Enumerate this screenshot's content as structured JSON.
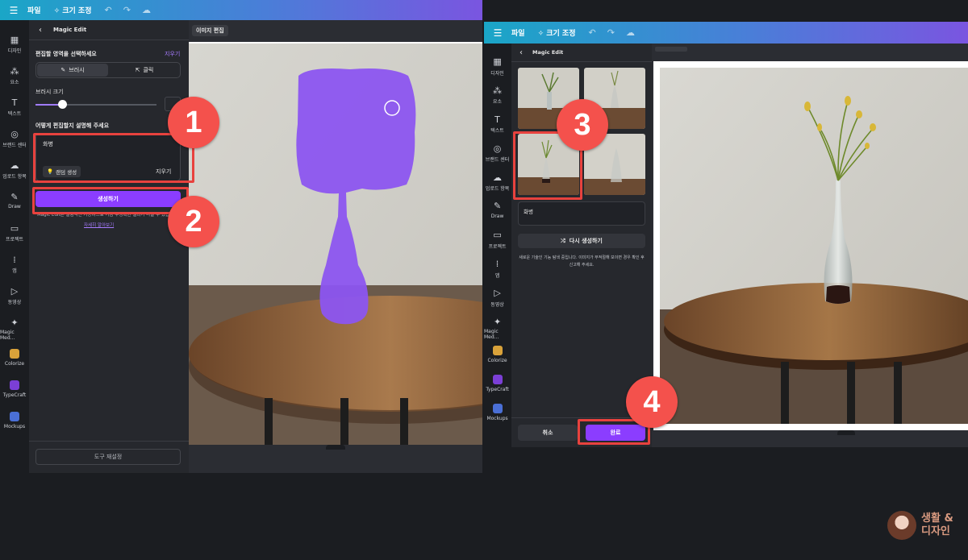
{
  "left": {
    "topbar": {
      "menu_icon": "menu-icon",
      "file": "파일",
      "resize": "✧ 크기 조정"
    },
    "rail": [
      {
        "label": "디자인",
        "icon": "▦"
      },
      {
        "label": "요소",
        "icon": "⁂"
      },
      {
        "label": "텍스트",
        "icon": "T"
      },
      {
        "label": "브랜드 센터",
        "icon": "◎"
      },
      {
        "label": "업로드 항목",
        "icon": "☁"
      },
      {
        "label": "Draw",
        "icon": "✎"
      },
      {
        "label": "프로젝트",
        "icon": "▭"
      },
      {
        "label": "앱",
        "icon": "⁞"
      },
      {
        "label": "동영상",
        "icon": "▷"
      },
      {
        "label": "Magic Med...",
        "icon": "✦"
      },
      {
        "label": "Colorize",
        "icon": ""
      },
      {
        "label": "TypeCraft",
        "icon": ""
      },
      {
        "label": "Mockups",
        "icon": ""
      }
    ],
    "panel": {
      "back": "‹",
      "title": "Magic Edit",
      "select_area": "편집할 영역을 선택하세요",
      "clear": "지우기",
      "tab_brush": "브러시",
      "tab_click": "클릭",
      "brush_size": "브러시 크기",
      "brush_value": 22,
      "describe": "어떻게 편집할지 설명해 주세요",
      "prompt": "화병",
      "random": "랜덤 생성",
      "prompt_clear": "지우기",
      "generate": "생성하기",
      "note": "Magic Edit는 실험적인 기능이므로 가끔 부정확한 결과가 나올 수 있습니다.",
      "learn_more": "자세히 알아보기",
      "tool_reset": "도구 재설정"
    },
    "canvas_tab": "이미지 편집"
  },
  "right": {
    "topbar": {
      "menu_icon": "menu-icon",
      "file": "파일",
      "resize": "✧ 크기 조정"
    },
    "rail": [
      {
        "label": "디자인",
        "icon": "▦"
      },
      {
        "label": "요소",
        "icon": "⁂"
      },
      {
        "label": "텍스트",
        "icon": "T"
      },
      {
        "label": "브랜드 센터",
        "icon": "◎"
      },
      {
        "label": "업로드 항목",
        "icon": "☁"
      },
      {
        "label": "Draw",
        "icon": "✎"
      },
      {
        "label": "프로젝트",
        "icon": "▭"
      },
      {
        "label": "앱",
        "icon": "⁞"
      },
      {
        "label": "동영상",
        "icon": "▷"
      },
      {
        "label": "Magic Med...",
        "icon": "✦"
      },
      {
        "label": "Colorize",
        "icon": ""
      },
      {
        "label": "TypeCraft",
        "icon": ""
      },
      {
        "label": "Mockups",
        "icon": ""
      }
    ],
    "panel": {
      "back": "‹",
      "title": "Magic Edit",
      "prompt": "화병",
      "regenerate": "다시 생성하기",
      "note": "새로운 기술인 기능 탐색 중입니다. 이미지가 부적절해 보이면 경우 확인 후 신고해 주세요.",
      "report": "신고",
      "cancel": "취소",
      "done": "완료"
    }
  },
  "callouts": [
    "1",
    "2",
    "3",
    "4"
  ],
  "watermark": {
    "line1": "생활 &",
    "line2": "디자인"
  },
  "colors": {
    "accent": "#8b3dff",
    "callout": "#f4514c",
    "mask": "#8c55f0"
  }
}
